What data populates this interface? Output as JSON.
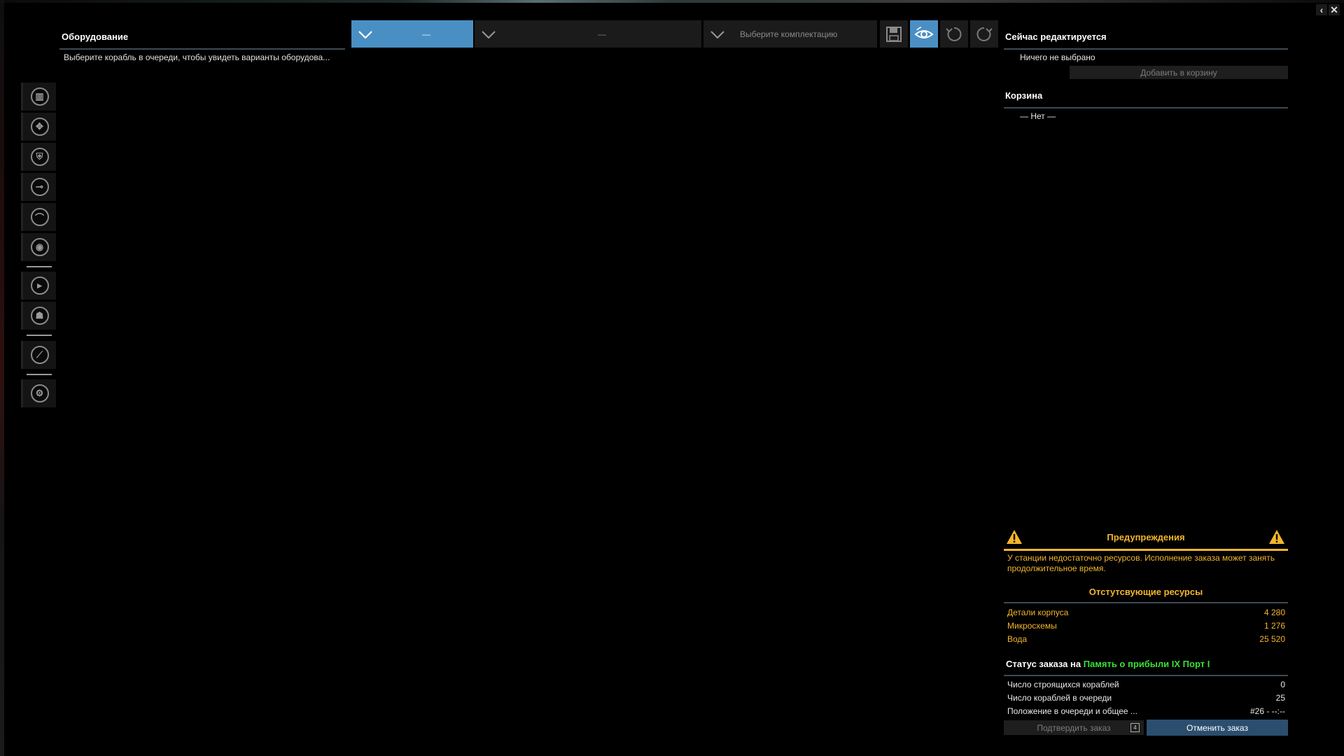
{
  "window": {
    "back_label": "‹",
    "close_label": "✕"
  },
  "left": {
    "title": "Оборудование",
    "hint": "Выберите корабль в очереди, чтобы увидеть варианты оборудова..."
  },
  "sidebar": {
    "groups": [
      {
        "icons": [
          "engine-icon",
          "thruster-icon",
          "shield-icon",
          "weapon-icon",
          "turret-icon",
          "deployables-icon"
        ]
      },
      {
        "icons": [
          "missile-icon",
          "crew-icon"
        ]
      },
      {
        "icons": [
          "paint-icon"
        ]
      },
      {
        "icons": [
          "settings-gear-icon"
        ]
      }
    ]
  },
  "toolbar": {
    "dropdown1": {
      "value": "—"
    },
    "dropdown2": {
      "value": "—"
    },
    "dropdown3": {
      "placeholder": "Выберите комплектацию"
    },
    "buttons": [
      "save-icon",
      "preview-eye-icon",
      "undo-icon",
      "redo-icon"
    ]
  },
  "right": {
    "editing_title": "Сейчас редактируется",
    "editing_value": "Ничего не выбрано",
    "add_to_cart": "Добавить в корзину",
    "cart_title": "Корзина",
    "cart_empty": "— Нет —",
    "warnings_title": "Предупреждения",
    "warning_text": "У станции недостаточно ресурсов. Исполнение заказа может занять продолжительное время.",
    "missing_title": "Отстутсвующие ресурсы",
    "missing_resources": [
      {
        "name": "Детали корпуса",
        "amount": "4 280"
      },
      {
        "name": "Микросхемы",
        "amount": "1 276"
      },
      {
        "name": "Вода",
        "amount": "25 520"
      }
    ],
    "status_prefix": "Статус заказа на",
    "status_ship": "Память о прибыли IX Порт I",
    "stats": [
      {
        "label": "Число строящихся кораблей",
        "value": "0"
      },
      {
        "label": "Число кораблей в очереди",
        "value": "25"
      },
      {
        "label": "Положение в очереди и общее ...",
        "value": "#26 - --:--"
      }
    ],
    "confirm_label": "Подтвердить заказ",
    "confirm_key": "4",
    "cancel_label": "Отменить заказ"
  },
  "colors": {
    "accent_blue": "#4a8fc4",
    "warning_orange": "#f2b62c",
    "ship_green": "#3ae03a"
  }
}
